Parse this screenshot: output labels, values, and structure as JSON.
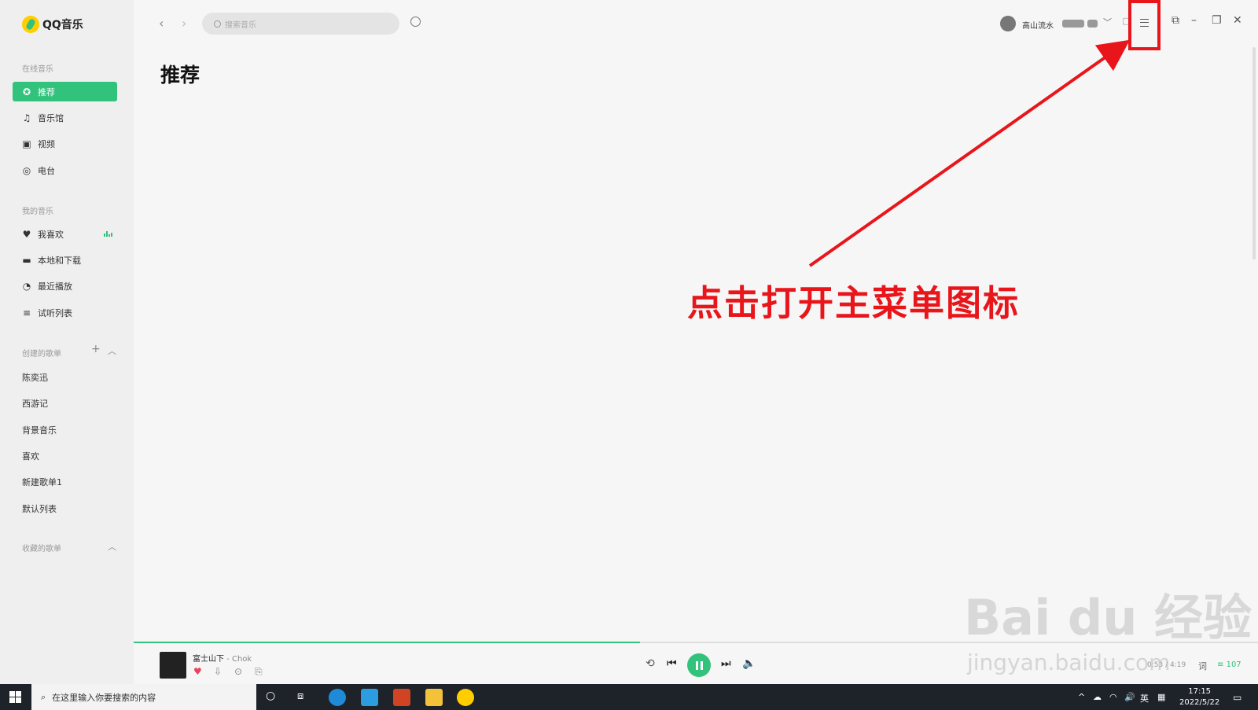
{
  "app": {
    "logo_text": "QQ音乐",
    "accent_color": "#31c27c"
  },
  "sidebar": {
    "online_title": "在线音乐",
    "online_items": [
      {
        "label": "推荐",
        "icon": "recommend-icon",
        "active": true
      },
      {
        "label": "音乐馆",
        "icon": "music-note-icon"
      },
      {
        "label": "视频",
        "icon": "video-icon"
      },
      {
        "label": "电台",
        "icon": "radio-icon"
      }
    ],
    "my_title": "我的音乐",
    "my_items": [
      {
        "label": "我喜欢",
        "icon": "heart-icon"
      },
      {
        "label": "本地和下载",
        "icon": "monitor-icon"
      },
      {
        "label": "最近播放",
        "icon": "clock-icon"
      },
      {
        "label": "试听列表",
        "icon": "list-icon"
      }
    ],
    "created_title": "创建的歌单",
    "created_playlists": [
      "陈奕迅",
      "西游记",
      "背景音乐",
      "喜欢",
      "新建歌单1",
      "默认列表"
    ],
    "favorited_title": "收藏的歌单"
  },
  "header": {
    "search_placeholder": "搜索音乐",
    "user_name": "高山流水"
  },
  "main": {
    "page_title": "推荐"
  },
  "annotation": {
    "text": "点击打开主菜单图标",
    "color": "#e8161b"
  },
  "player": {
    "song_title": "富士山下",
    "song_artist": " - Chok",
    "progress": 0.45,
    "time": "0:53 / 4:19",
    "lyric_label": "词",
    "playlist_count": "107"
  },
  "watermark": {
    "text": "Bai du 经验",
    "url": "jingyan.baidu.com"
  },
  "taskbar": {
    "search_placeholder": "在这里输入你要搜索的内容",
    "ime": "英",
    "time": "17:15",
    "date": "2022/5/22"
  }
}
